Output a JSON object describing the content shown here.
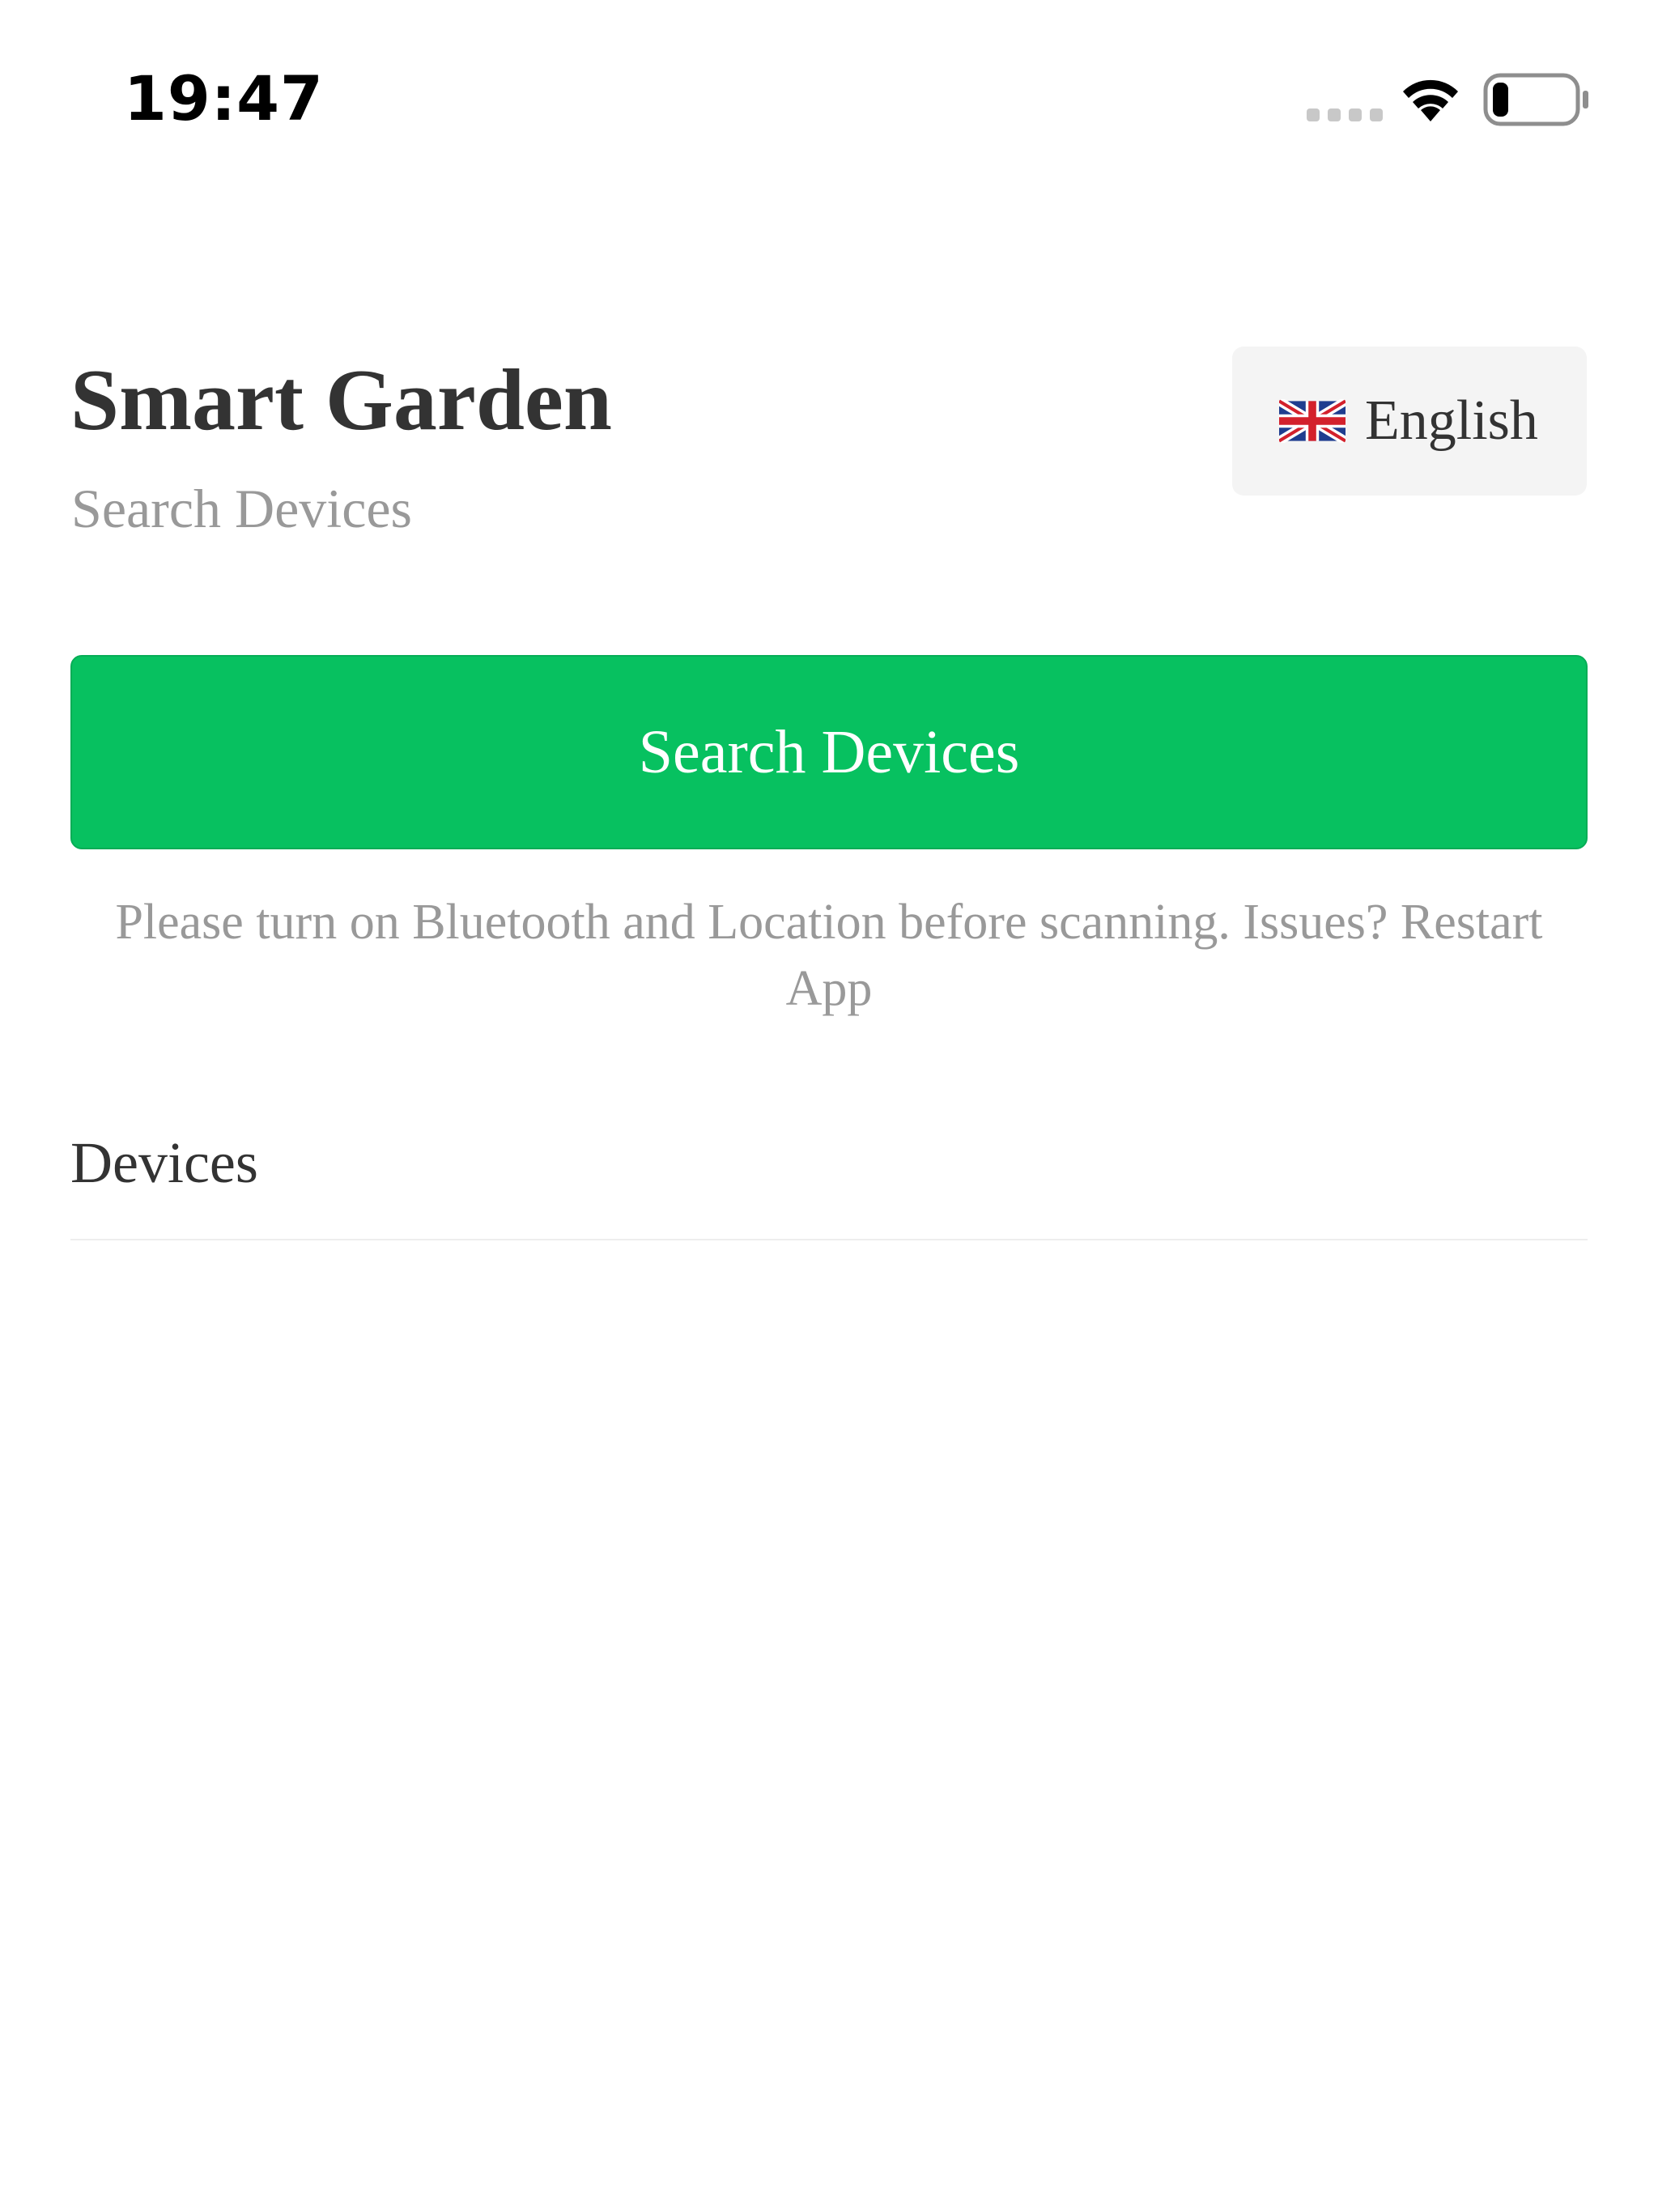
{
  "status_bar": {
    "time": "19:47",
    "signal_icon": "signal-dots-icon",
    "wifi_icon": "wifi-icon",
    "battery_icon": "battery-icon",
    "battery_level": 0.2
  },
  "header": {
    "title": "Smart Garden",
    "subtitle": "Search Devices"
  },
  "language_selector": {
    "flag_icon": "uk-flag-icon",
    "label": "English"
  },
  "actions": {
    "search_button_label": "Search Devices"
  },
  "hint": {
    "text": "Please turn on Bluetooth and Location before scanning. Issues? Restart App"
  },
  "devices": {
    "heading": "Devices",
    "items": []
  },
  "colors": {
    "primary_green": "#07c160",
    "title_text": "#333333",
    "muted_text": "#999999",
    "language_bg": "#f4f4f4"
  }
}
